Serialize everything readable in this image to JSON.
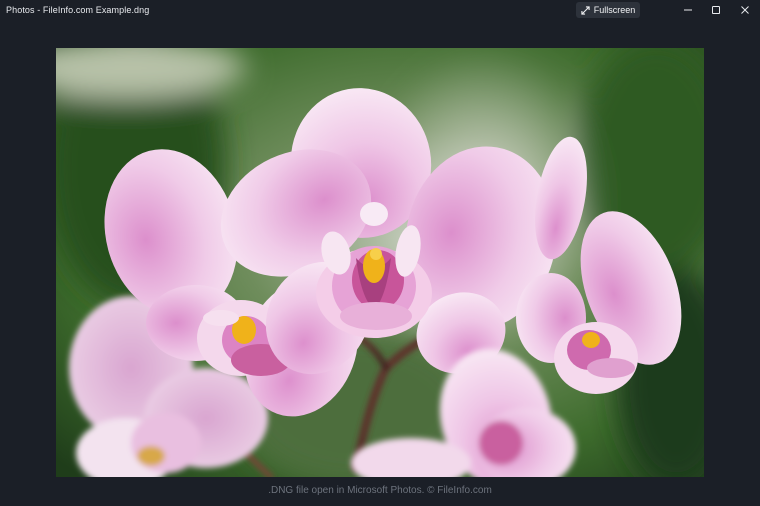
{
  "window": {
    "title": "Photos - FileInfo.com Example.dng",
    "background": "#1b1f27"
  },
  "toolbar": {
    "fullscreen_label": "Fullscreen",
    "fullscreen_icon": "expand-arrows-icon"
  },
  "window_controls": {
    "minimize_icon": "minimize-icon",
    "maximize_icon": "maximize-icon",
    "close_icon": "close-icon"
  },
  "photo": {
    "subject_icon": "orchid-photo",
    "accent_colors": {
      "petal": "#f4dcef",
      "petal_center": "#d98ac6",
      "lip": "#c8559a",
      "pollen": "#f0b21a",
      "background": "#3d6b2c"
    }
  },
  "caption": {
    "text": ".DNG file open in Microsoft Photos. © FileInfo.com"
  }
}
